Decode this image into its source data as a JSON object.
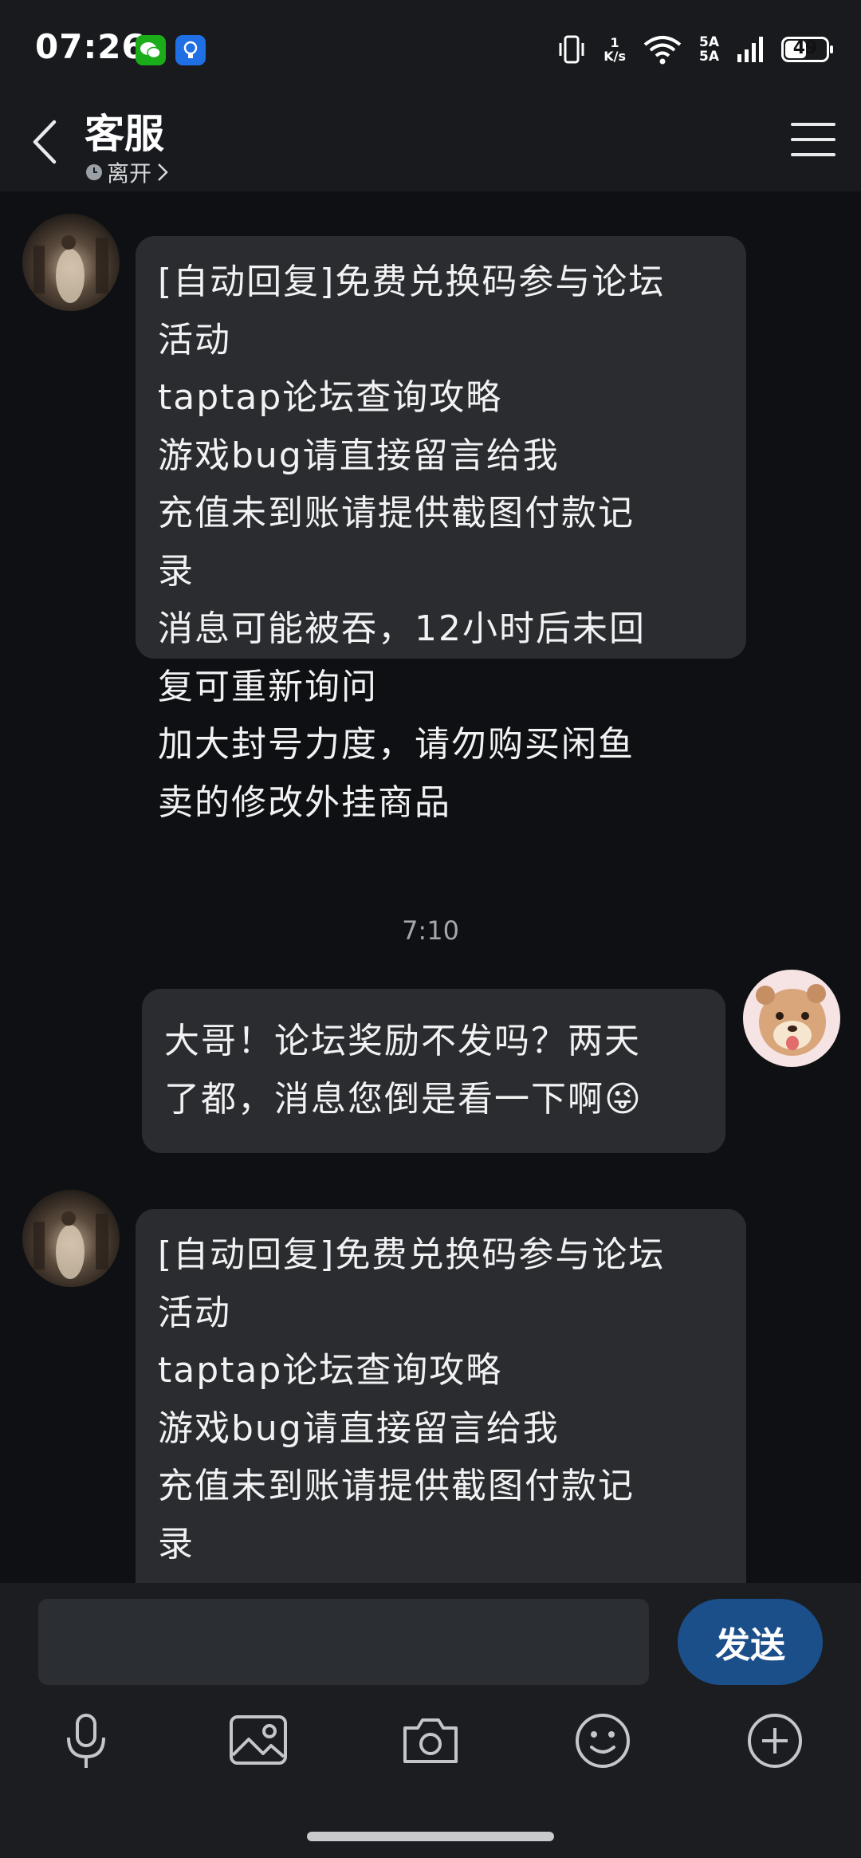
{
  "status_bar": {
    "time": "07:26",
    "network_speed_value": "1",
    "network_speed_unit": "K/s",
    "signal_label_top": "5A",
    "signal_label_bottom": "5A",
    "battery": "49",
    "icons": [
      "wechat-icon",
      "bulb-icon",
      "vibrate-icon",
      "wifi-icon",
      "signal-icon",
      "battery-icon"
    ]
  },
  "header": {
    "title": "客服",
    "status": "离开",
    "icons": [
      "back-icon",
      "clock-icon",
      "chevron-right-icon",
      "menu-icon"
    ]
  },
  "messages": [
    {
      "side": "left",
      "lines": [
        "[自动回复]免费兑换码参与论坛",
        "活动",
        "taptap论坛查询攻略",
        "游戏bug请直接留言给我",
        "充值未到账请提供截图付款记",
        "录",
        "消息可能被吞，12小时后未回",
        "复可重新询问",
        "加大封号力度，请勿购买闲鱼",
        "卖的修改外挂商品"
      ]
    },
    {
      "side": "right",
      "lines": [
        "大哥！论坛奖励不发吗？两天",
        "了都，消息您倒是看一下啊😜"
      ]
    },
    {
      "side": "left",
      "lines": [
        "[自动回复]免费兑换码参与论坛",
        "活动",
        "taptap论坛查询攻略",
        "游戏bug请直接留言给我",
        "充值未到账请提供截图付款记",
        "录"
      ]
    }
  ],
  "time_separator": "7:10",
  "input": {
    "placeholder": "",
    "value": "",
    "send_label": "发送"
  },
  "toolbar_icons": [
    "microphone-icon",
    "image-icon",
    "camera-icon",
    "emoji-icon",
    "plus-icon"
  ],
  "colors": {
    "background": "#0e1013",
    "bubble": "#2a2c30",
    "send_button": "#1b4f8a",
    "header": "#181a1e"
  }
}
